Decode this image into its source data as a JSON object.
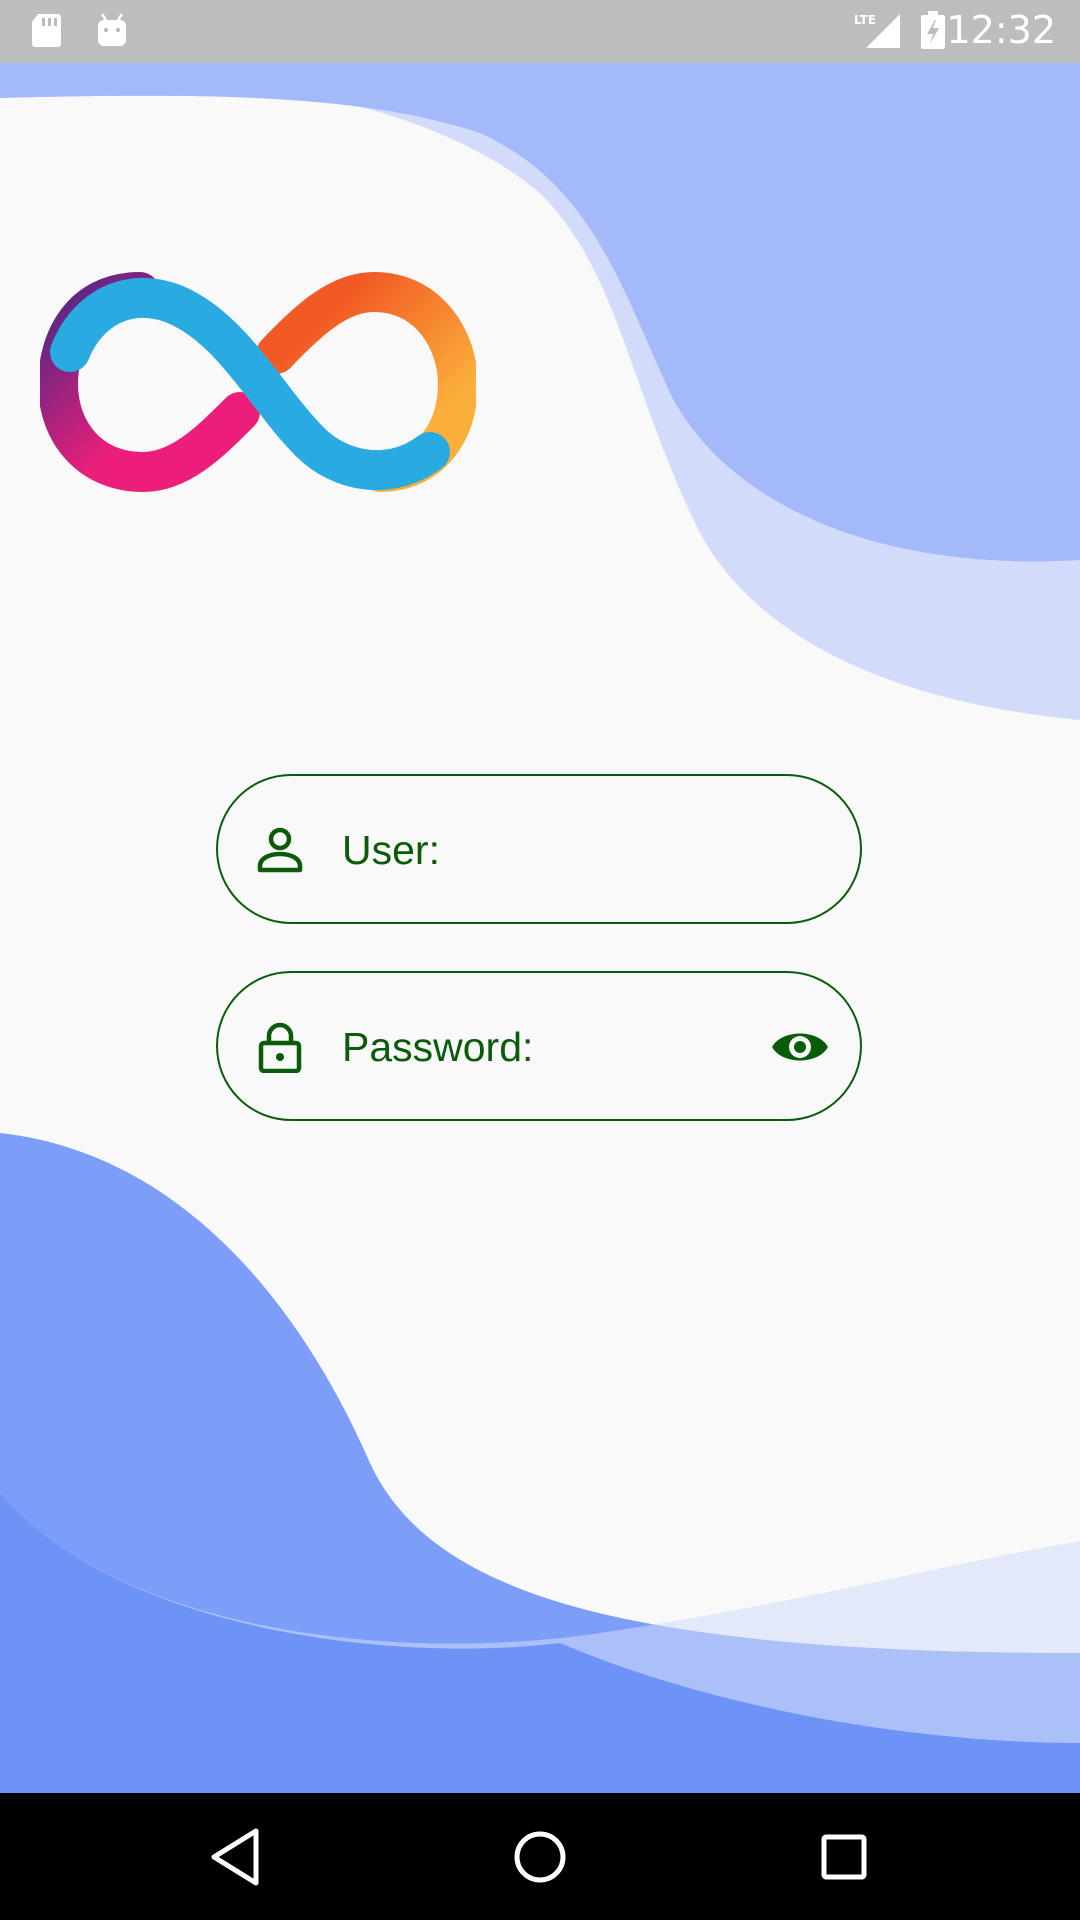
{
  "status_bar": {
    "time": "12:32",
    "network": "LTE",
    "icons": [
      "sd-card-icon",
      "android-icon",
      "lte-signal-icon",
      "battery-charging-icon"
    ]
  },
  "logo": {
    "name": "infinity-logo-icon"
  },
  "form": {
    "user": {
      "label": "User:",
      "icon": "person-icon"
    },
    "password": {
      "label": "Password:",
      "icon": "lock-icon",
      "toggle_icon": "eye-icon"
    }
  },
  "nav": {
    "icons": [
      "back-icon",
      "home-icon",
      "recents-icon"
    ]
  },
  "colors": {
    "accent": "#0a5c0a",
    "wave_light": "#d2dcfa",
    "wave_mid": "#9fb6fa",
    "wave_strong": "#6e93f7",
    "status_bar": "#bdbdbd",
    "nav_bar": "#000000"
  }
}
